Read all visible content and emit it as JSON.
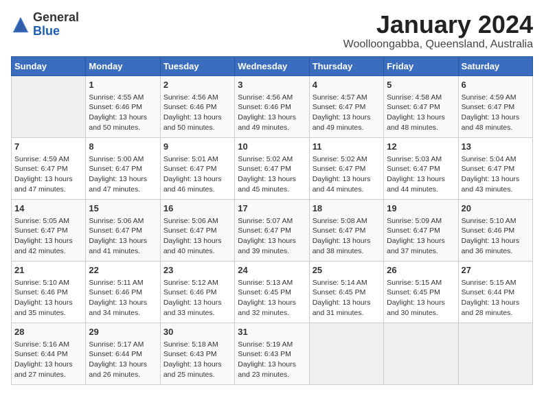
{
  "logo": {
    "general": "General",
    "blue": "Blue"
  },
  "title": "January 2024",
  "subtitle": "Woolloongabba, Queensland, Australia",
  "days_of_week": [
    "Sunday",
    "Monday",
    "Tuesday",
    "Wednesday",
    "Thursday",
    "Friday",
    "Saturday"
  ],
  "weeks": [
    [
      {
        "day": "",
        "info": ""
      },
      {
        "day": "1",
        "info": "Sunrise: 4:55 AM\nSunset: 6:46 PM\nDaylight: 13 hours\nand 50 minutes."
      },
      {
        "day": "2",
        "info": "Sunrise: 4:56 AM\nSunset: 6:46 PM\nDaylight: 13 hours\nand 50 minutes."
      },
      {
        "day": "3",
        "info": "Sunrise: 4:56 AM\nSunset: 6:46 PM\nDaylight: 13 hours\nand 49 minutes."
      },
      {
        "day": "4",
        "info": "Sunrise: 4:57 AM\nSunset: 6:47 PM\nDaylight: 13 hours\nand 49 minutes."
      },
      {
        "day": "5",
        "info": "Sunrise: 4:58 AM\nSunset: 6:47 PM\nDaylight: 13 hours\nand 48 minutes."
      },
      {
        "day": "6",
        "info": "Sunrise: 4:59 AM\nSunset: 6:47 PM\nDaylight: 13 hours\nand 48 minutes."
      }
    ],
    [
      {
        "day": "7",
        "info": "Sunrise: 4:59 AM\nSunset: 6:47 PM\nDaylight: 13 hours\nand 47 minutes."
      },
      {
        "day": "8",
        "info": "Sunrise: 5:00 AM\nSunset: 6:47 PM\nDaylight: 13 hours\nand 47 minutes."
      },
      {
        "day": "9",
        "info": "Sunrise: 5:01 AM\nSunset: 6:47 PM\nDaylight: 13 hours\nand 46 minutes."
      },
      {
        "day": "10",
        "info": "Sunrise: 5:02 AM\nSunset: 6:47 PM\nDaylight: 13 hours\nand 45 minutes."
      },
      {
        "day": "11",
        "info": "Sunrise: 5:02 AM\nSunset: 6:47 PM\nDaylight: 13 hours\nand 44 minutes."
      },
      {
        "day": "12",
        "info": "Sunrise: 5:03 AM\nSunset: 6:47 PM\nDaylight: 13 hours\nand 44 minutes."
      },
      {
        "day": "13",
        "info": "Sunrise: 5:04 AM\nSunset: 6:47 PM\nDaylight: 13 hours\nand 43 minutes."
      }
    ],
    [
      {
        "day": "14",
        "info": "Sunrise: 5:05 AM\nSunset: 6:47 PM\nDaylight: 13 hours\nand 42 minutes."
      },
      {
        "day": "15",
        "info": "Sunrise: 5:06 AM\nSunset: 6:47 PM\nDaylight: 13 hours\nand 41 minutes."
      },
      {
        "day": "16",
        "info": "Sunrise: 5:06 AM\nSunset: 6:47 PM\nDaylight: 13 hours\nand 40 minutes."
      },
      {
        "day": "17",
        "info": "Sunrise: 5:07 AM\nSunset: 6:47 PM\nDaylight: 13 hours\nand 39 minutes."
      },
      {
        "day": "18",
        "info": "Sunrise: 5:08 AM\nSunset: 6:47 PM\nDaylight: 13 hours\nand 38 minutes."
      },
      {
        "day": "19",
        "info": "Sunrise: 5:09 AM\nSunset: 6:47 PM\nDaylight: 13 hours\nand 37 minutes."
      },
      {
        "day": "20",
        "info": "Sunrise: 5:10 AM\nSunset: 6:46 PM\nDaylight: 13 hours\nand 36 minutes."
      }
    ],
    [
      {
        "day": "21",
        "info": "Sunrise: 5:10 AM\nSunset: 6:46 PM\nDaylight: 13 hours\nand 35 minutes."
      },
      {
        "day": "22",
        "info": "Sunrise: 5:11 AM\nSunset: 6:46 PM\nDaylight: 13 hours\nand 34 minutes."
      },
      {
        "day": "23",
        "info": "Sunrise: 5:12 AM\nSunset: 6:46 PM\nDaylight: 13 hours\nand 33 minutes."
      },
      {
        "day": "24",
        "info": "Sunrise: 5:13 AM\nSunset: 6:45 PM\nDaylight: 13 hours\nand 32 minutes."
      },
      {
        "day": "25",
        "info": "Sunrise: 5:14 AM\nSunset: 6:45 PM\nDaylight: 13 hours\nand 31 minutes."
      },
      {
        "day": "26",
        "info": "Sunrise: 5:15 AM\nSunset: 6:45 PM\nDaylight: 13 hours\nand 30 minutes."
      },
      {
        "day": "27",
        "info": "Sunrise: 5:15 AM\nSunset: 6:44 PM\nDaylight: 13 hours\nand 28 minutes."
      }
    ],
    [
      {
        "day": "28",
        "info": "Sunrise: 5:16 AM\nSunset: 6:44 PM\nDaylight: 13 hours\nand 27 minutes."
      },
      {
        "day": "29",
        "info": "Sunrise: 5:17 AM\nSunset: 6:44 PM\nDaylight: 13 hours\nand 26 minutes."
      },
      {
        "day": "30",
        "info": "Sunrise: 5:18 AM\nSunset: 6:43 PM\nDaylight: 13 hours\nand 25 minutes."
      },
      {
        "day": "31",
        "info": "Sunrise: 5:19 AM\nSunset: 6:43 PM\nDaylight: 13 hours\nand 23 minutes."
      },
      {
        "day": "",
        "info": ""
      },
      {
        "day": "",
        "info": ""
      },
      {
        "day": "",
        "info": ""
      }
    ]
  ]
}
